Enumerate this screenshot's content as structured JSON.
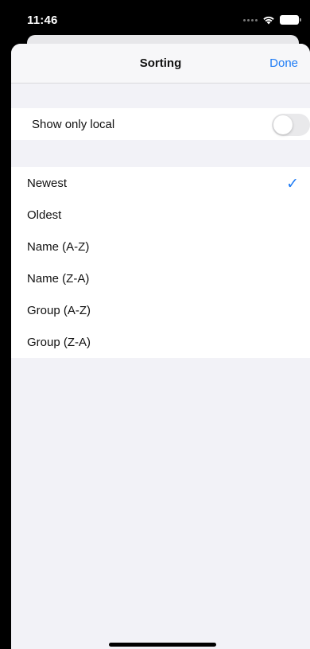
{
  "status_bar": {
    "time": "11:46",
    "icons": [
      "signal-dots-icon",
      "wifi-icon",
      "battery-icon"
    ]
  },
  "sheet": {
    "title": "Sorting",
    "done_label": "Done"
  },
  "filter": {
    "show_only_local_label": "Show only local",
    "show_only_local_on": false
  },
  "sorting": {
    "options": [
      {
        "label": "Newest",
        "selected": true
      },
      {
        "label": "Oldest",
        "selected": false
      },
      {
        "label": "Name (A-Z)",
        "selected": false
      },
      {
        "label": "Name (Z-A)",
        "selected": false
      },
      {
        "label": "Group (A-Z)",
        "selected": false
      },
      {
        "label": "Group (Z-A)",
        "selected": false
      }
    ],
    "check_glyph": "✓"
  },
  "colors": {
    "accent": "#1f7cf5",
    "grouped_background": "#f2f2f7",
    "cell_background": "#ffffff",
    "switch_off": "#e9e9eb"
  }
}
